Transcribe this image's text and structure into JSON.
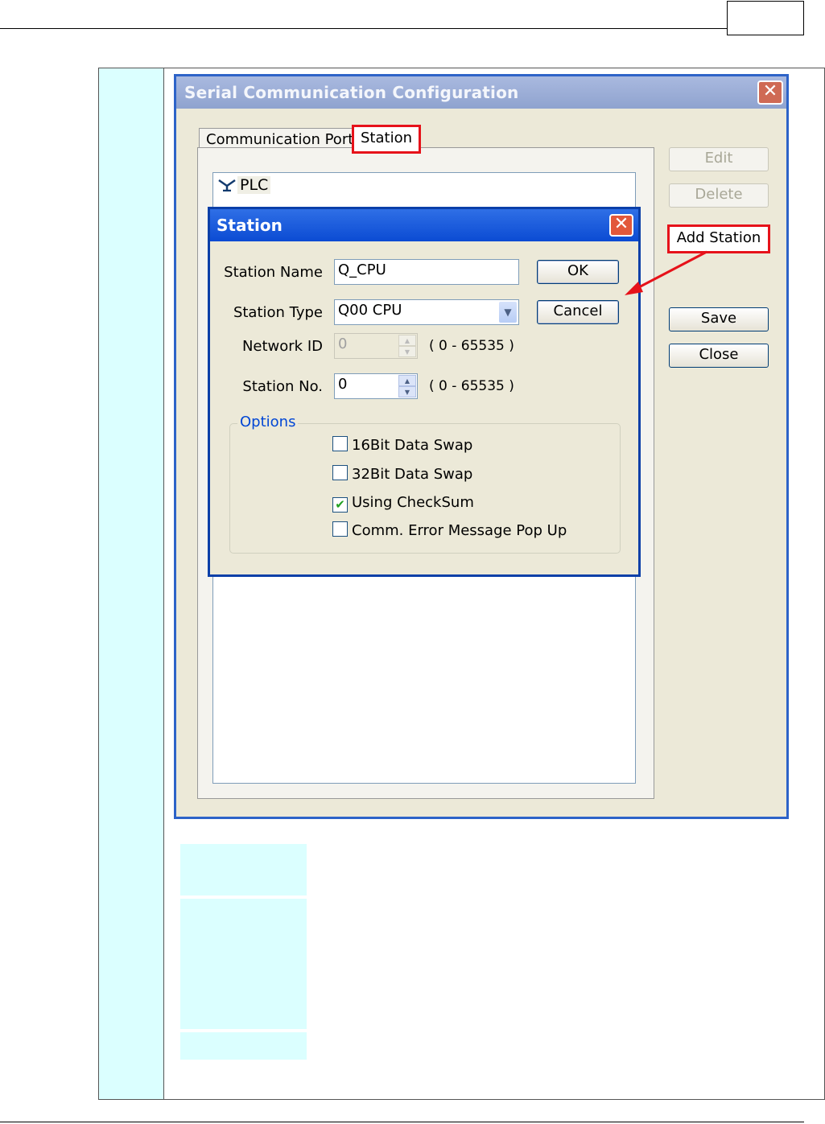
{
  "main_dialog": {
    "title": "Serial Communication Configuration",
    "close_glyph": "✕",
    "tabs": [
      {
        "label": "Communication Port",
        "active": false
      },
      {
        "label": "Station",
        "active": true
      }
    ],
    "tree": {
      "icon": "network-node-icon",
      "node_label": "PLC"
    },
    "buttons": {
      "edit": "Edit",
      "delete": "Delete",
      "add_station": "Add Station",
      "save": "Save",
      "close": "Close"
    }
  },
  "station_dialog": {
    "title": "Station",
    "close_glyph": "✕",
    "fields": {
      "station_name_label": "Station Name",
      "station_name_value": "Q_CPU",
      "station_type_label": "Station Type",
      "station_type_value": "Q00 CPU",
      "network_id_label": "Network ID",
      "network_id_value": "0",
      "network_id_range": "( 0 - 65535 )",
      "station_no_label": "Station No.",
      "station_no_value": "0",
      "station_no_range": "( 0 - 65535 )"
    },
    "buttons": {
      "ok": "OK",
      "cancel": "Cancel"
    },
    "options": {
      "legend": "Options",
      "items": [
        {
          "label": "16Bit Data Swap",
          "checked": false
        },
        {
          "label": "32Bit Data Swap",
          "checked": false
        },
        {
          "label": "Using CheckSum",
          "checked": true
        },
        {
          "label": "Comm. Error Message Pop Up",
          "checked": false
        }
      ]
    }
  },
  "icons": {
    "checkmark": "✔",
    "dropdown": "▼",
    "spin_up": "▲",
    "spin_down": "▼"
  },
  "colors": {
    "highlight_red": "#e6121a",
    "titlebar_blue": "#0b4bd3",
    "cell_cyan": "#dbffff",
    "dialog_face": "#ece9d8"
  }
}
